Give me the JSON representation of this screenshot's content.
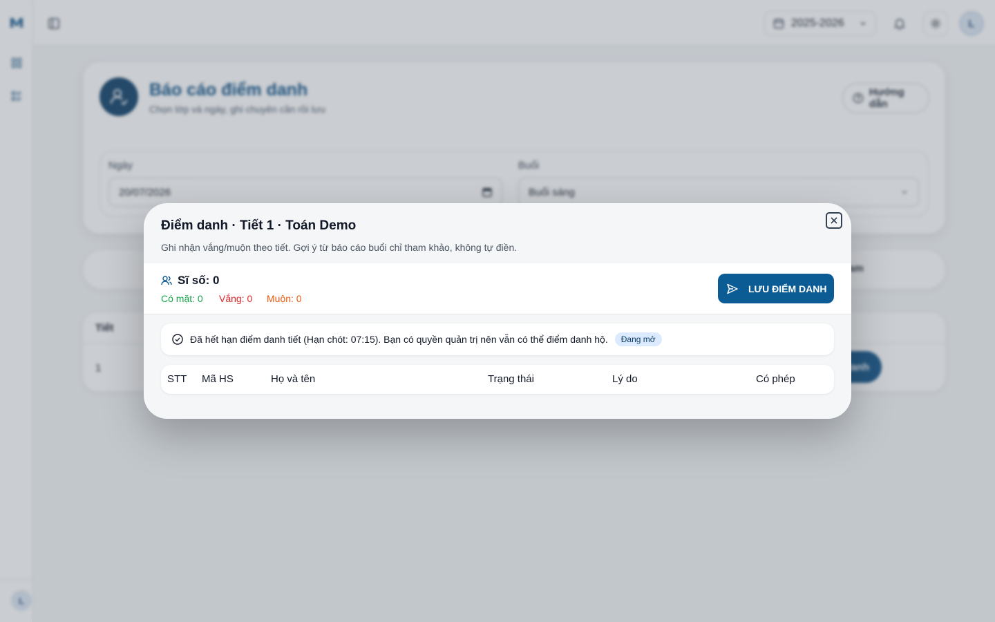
{
  "topbar": {
    "year": "2025-2026",
    "avatar_initial": "L"
  },
  "rail": {
    "avatar_initial": "L"
  },
  "page": {
    "title": "Báo cáo điểm danh",
    "subtitle": "Chọn lớp và ngày, ghi chuyên cần rồi lưu",
    "help_label": "Hướng dẫn",
    "filters": {
      "date_label": "Ngày",
      "date_value": "20/07/2026",
      "session_label": "Buổi",
      "session_value": "Buổi sáng"
    },
    "tabs_right_fragment": "am",
    "table": {
      "header_period": "Tiết",
      "row_period": "1",
      "row_button_fragment": "danh"
    }
  },
  "modal": {
    "title": "Điểm danh · Tiết 1 · Toán Demo",
    "description": "Ghi nhận vắng/muộn theo tiết. Gợi ý từ báo cáo buổi chỉ tham khảo, không tự điền.",
    "roster": "Sĩ số: 0",
    "present": "Có mặt: 0",
    "absent": "Vắng: 0",
    "late": "Muộn: 0",
    "save_label": "LƯU ĐIỂM DANH",
    "notice": "Đã hết hạn điểm danh tiết (Hạn chót: 07:15). Bạn có quyền quản trị nên vẫn có thể điểm danh hộ.",
    "badge": "Đang mở",
    "columns": [
      "STT",
      "Mã HS",
      "Họ và tên",
      "Trạng thái",
      "Lý do",
      "Có phép"
    ]
  },
  "colors": {
    "brand": "#0b4f85",
    "present": "#16a34a",
    "absent": "#dc2626",
    "late": "#ea580c"
  }
}
